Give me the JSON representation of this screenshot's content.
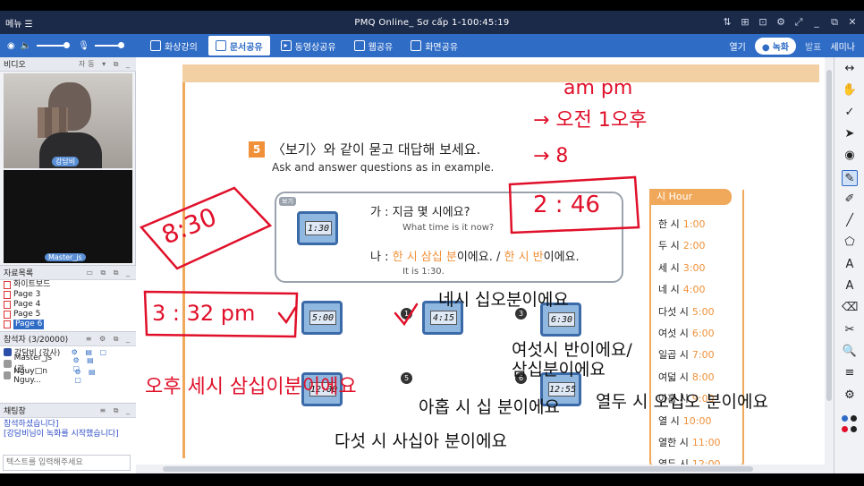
{
  "titlebar": {
    "menu_label": "메뉴 ☰",
    "title": "PMQ Online_ Sơ cấp 1-100:45:19",
    "controls": [
      "⇅",
      "⊞",
      "⊡",
      "⚙",
      "⤢",
      "_",
      "⧉",
      "✕"
    ]
  },
  "toolbar": {
    "tabs": [
      {
        "label": "화상강의",
        "icon": "camera"
      },
      {
        "label": "문서공유",
        "icon": "document",
        "active": true
      },
      {
        "label": "동영상공유",
        "icon": "video"
      },
      {
        "label": "웹공유",
        "icon": "web"
      },
      {
        "label": "화면공유",
        "icon": "screen"
      }
    ],
    "open_label": "열기",
    "record_label": "녹화",
    "present_label": "발표",
    "seminar_label": "세미나"
  },
  "video_panel": {
    "title": "비디오",
    "auto_label": "자동 ▾",
    "teacher_name": "강담비",
    "student_name": "Master_js"
  },
  "files_panel": {
    "title": "자료목록",
    "items": [
      {
        "label": "화이트보드"
      },
      {
        "label": "Page 3"
      },
      {
        "label": "Page 4"
      },
      {
        "label": "Page 5"
      },
      {
        "label": "Page 6",
        "selected": true
      }
    ]
  },
  "attendees_panel": {
    "title": "참석자 (3/20000)",
    "items": [
      {
        "name": "강담비 (강사)"
      },
      {
        "name": "Master_js (관..."
      },
      {
        "name": "Nguy□n Nguy..."
      }
    ]
  },
  "chat_panel": {
    "title": "채팅창",
    "messages": [
      "참석하셨습니다]",
      "[강담비님이 녹화를 시작했습니다]"
    ],
    "placeholder": "텍스트를 입력해주세요"
  },
  "document": {
    "question_number": "5",
    "question_ko": "〈보기〉와 같이 묻고 대답해 보세요.",
    "question_en": "Ask and answer questions as in example.",
    "example_tag": "보기",
    "example_clock": "1:30",
    "line_ga_prefix": "가 : ",
    "line_ga": "지금 몇 시에요?",
    "line_ga_en": "What time is it now?",
    "line_na_prefix": "나 : ",
    "line_na_a": "한 시 삼십 분",
    "line_na_b": "이에요. / ",
    "line_na_c": "한 시 반",
    "line_na_d": "이에요.",
    "line_na_en": "It is 1:30.",
    "exercise_clocks": [
      "5:00",
      "4:15",
      "6:30",
      "12:00",
      "12:55"
    ],
    "exercise_numbers": [
      "1",
      "3",
      "5",
      "6"
    ],
    "hours_title": "시 Hour",
    "hours": [
      {
        "ko": "한 시",
        "t": "1:00"
      },
      {
        "ko": "두 시",
        "t": "2:00"
      },
      {
        "ko": "세 시",
        "t": "3:00"
      },
      {
        "ko": "네 시",
        "t": "4:00"
      },
      {
        "ko": "다섯 시",
        "t": "5:00"
      },
      {
        "ko": "여섯 시",
        "t": "6:00"
      },
      {
        "ko": "일곱 시",
        "t": "7:00"
      },
      {
        "ko": "여덟 시",
        "t": "8:00"
      },
      {
        "ko": "아홉 시",
        "t": "9:00"
      },
      {
        "ko": "열 시",
        "t": "10:00"
      },
      {
        "ko": "열한 시",
        "t": "11:00"
      },
      {
        "ko": "열두 시",
        "t": "12:00"
      }
    ]
  },
  "annotations": {
    "handwriting_am_pm": "am    pm",
    "handwriting_ojeon_ohu": "→ 오전  1오후",
    "handwriting_8": "→ 8",
    "handwriting_2_46": "2 : 46",
    "handwriting_8_30": "8:30",
    "handwriting_3_32": "3 : 32 pm",
    "handwriting_ohu_sentence": "오후 세시 삼십이분이에요",
    "typed_1": "네시 십오분이에요",
    "typed_2": "여섯시 반이에요/",
    "typed_3": "삼십분이에요",
    "typed_4": "아홉 시 십 분이에요",
    "typed_5": "열두 시 오십오 분이에요",
    "typed_6": "다섯 시 사십아 분이에요"
  },
  "colors": {
    "titlebar": "#1c2a4a",
    "toolbar": "#2f6cc6",
    "annotation_red": "#e0102a",
    "accent_orange": "#f0913a"
  },
  "right_tools": [
    "↔",
    "✋",
    "✓",
    "➤",
    "◉",
    "✎",
    "✐",
    "╱",
    "⬠",
    "A",
    "A",
    "⌫",
    "✂",
    "🔍",
    "≡",
    "⚙"
  ]
}
